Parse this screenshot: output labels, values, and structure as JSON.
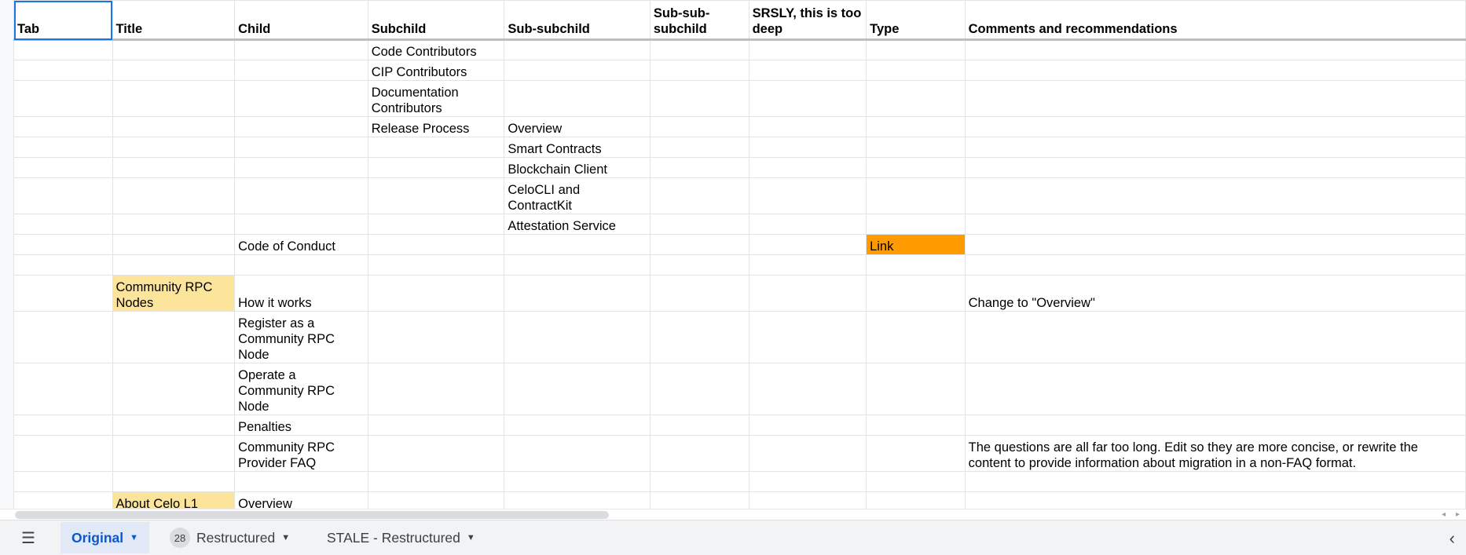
{
  "headers": [
    "Tab",
    "Title",
    "Child",
    "Subchild",
    "Sub-subchild",
    "Sub-sub-subchild",
    "SRSLY, this is too deep",
    "Type",
    "Comments and recommendations"
  ],
  "rows": [
    [
      "",
      "",
      "",
      "Code Contributors",
      "",
      "",
      "",
      "",
      ""
    ],
    [
      "",
      "",
      "",
      "CIP Contributors",
      "",
      "",
      "",
      "",
      ""
    ],
    [
      "",
      "",
      "",
      "Documentation Contributors",
      "",
      "",
      "",
      "",
      ""
    ],
    [
      "",
      "",
      "",
      "Release Process",
      "Overview",
      "",
      "",
      "",
      ""
    ],
    [
      "",
      "",
      "",
      "",
      "Smart Contracts",
      "",
      "",
      "",
      ""
    ],
    [
      "",
      "",
      "",
      "",
      "Blockchain Client",
      "",
      "",
      "",
      ""
    ],
    [
      "",
      "",
      "",
      "",
      "CeloCLI and ContractKit",
      "",
      "",
      "",
      ""
    ],
    [
      "",
      "",
      "",
      "",
      "Attestation Service",
      "",
      "",
      "",
      ""
    ],
    [
      "",
      "",
      "Code of Conduct",
      "",
      "",
      "",
      "",
      "Link",
      ""
    ],
    [
      "",
      "",
      "",
      "",
      "",
      "",
      "",
      "",
      ""
    ],
    [
      "",
      "Community RPC Nodes",
      "How it works",
      "",
      "",
      "",
      "",
      "",
      "Change to \"Overview\""
    ],
    [
      "",
      "",
      "Register as a Community RPC Node",
      "",
      "",
      "",
      "",
      "",
      ""
    ],
    [
      "",
      "",
      "Operate a Community RPC Node",
      "",
      "",
      "",
      "",
      "",
      ""
    ],
    [
      "",
      "",
      "Penalties",
      "",
      "",
      "",
      "",
      "",
      ""
    ],
    [
      "",
      "",
      "Community RPC Provider FAQ",
      "",
      "",
      "",
      "",
      "",
      "The questions are all far too long. Edit so they are more concise, or rewrite the content to provide information about migration in a non-FAQ format."
    ],
    [
      "",
      "",
      "",
      "",
      "",
      "",
      "",
      "",
      ""
    ],
    [
      "",
      "About Celo L1",
      "Overview",
      "",
      "",
      "",
      "",
      "",
      ""
    ]
  ],
  "colors": {
    "title_highlight": "#fce49a",
    "type_link": "#ff9a00",
    "active_tab": "#0b57d0"
  },
  "sheet_tabs": [
    {
      "label": "Original",
      "active": true
    },
    {
      "label": "Restructured",
      "badge": "28"
    },
    {
      "label": "STALE - Restructured"
    }
  ],
  "icons": {
    "menu": "hamburger-menu-icon",
    "collapse": "chevron-left-icon"
  }
}
